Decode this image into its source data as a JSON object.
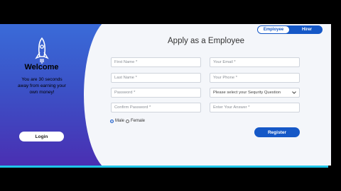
{
  "left": {
    "welcome": "Welcome",
    "subtitle": "You are 30 seconds away from earning your own money!",
    "login_label": "Login"
  },
  "toggle": {
    "employee": "Employee",
    "hirer": "Hirer"
  },
  "form": {
    "title": "Apply as a Employee",
    "first_name": "First Name *",
    "last_name": "Last Name *",
    "password": "Password *",
    "confirm_password": "Confirm Password *",
    "email": "Your Email *",
    "phone": "Your Phone *",
    "security_question": "Please select your Sequrity Question",
    "answer": "Enter Your Answer *",
    "male": "Male",
    "female": "Female",
    "register_label": "Register"
  },
  "colors": {
    "accent": "#1558c7",
    "gradient_top": "#3a6bd8",
    "gradient_bottom": "#4a2fb2",
    "strip": "#20c6e8"
  }
}
